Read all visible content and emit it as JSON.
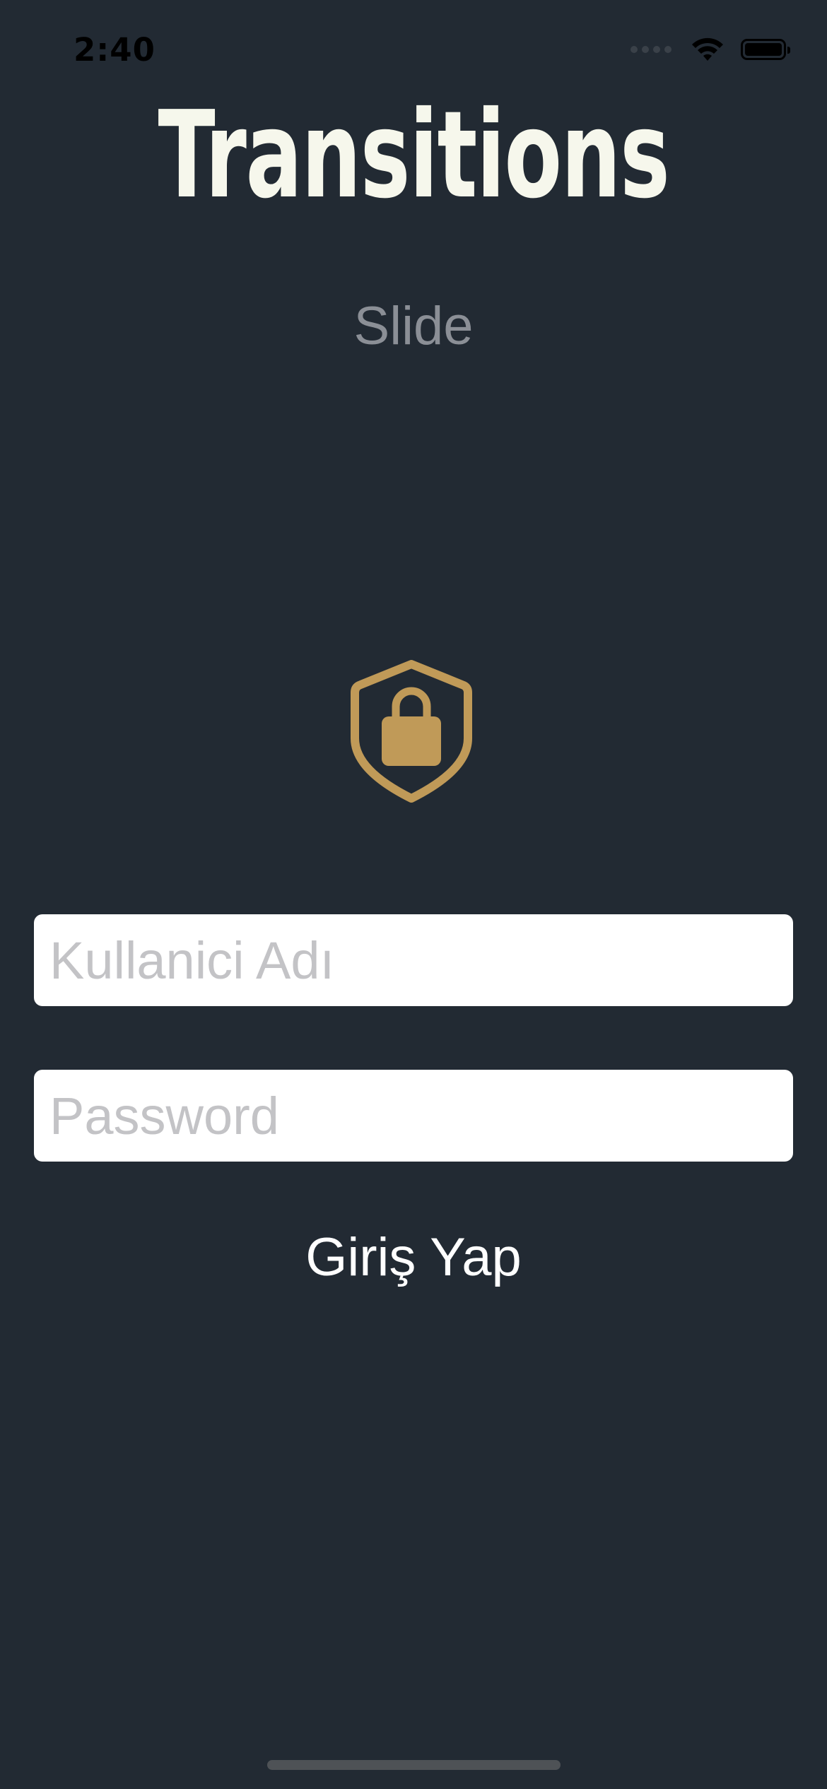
{
  "status_bar": {
    "time": "2:40",
    "icons": [
      "cellular-signal-icon",
      "wifi-icon",
      "battery-icon"
    ]
  },
  "header": {
    "title": "Transitions",
    "subtitle": "Slide"
  },
  "logo": {
    "icon": "shield-lock-icon",
    "color": "#c09a58"
  },
  "form": {
    "username_placeholder": "Kullanici Adı",
    "username_value": "",
    "password_placeholder": "Password",
    "password_value": "",
    "submit_label": "Giriş Yap"
  },
  "colors": {
    "background": "#222a33",
    "title": "#f6f7ec",
    "subtitle": "#8b8f96",
    "accent": "#c09a58"
  }
}
